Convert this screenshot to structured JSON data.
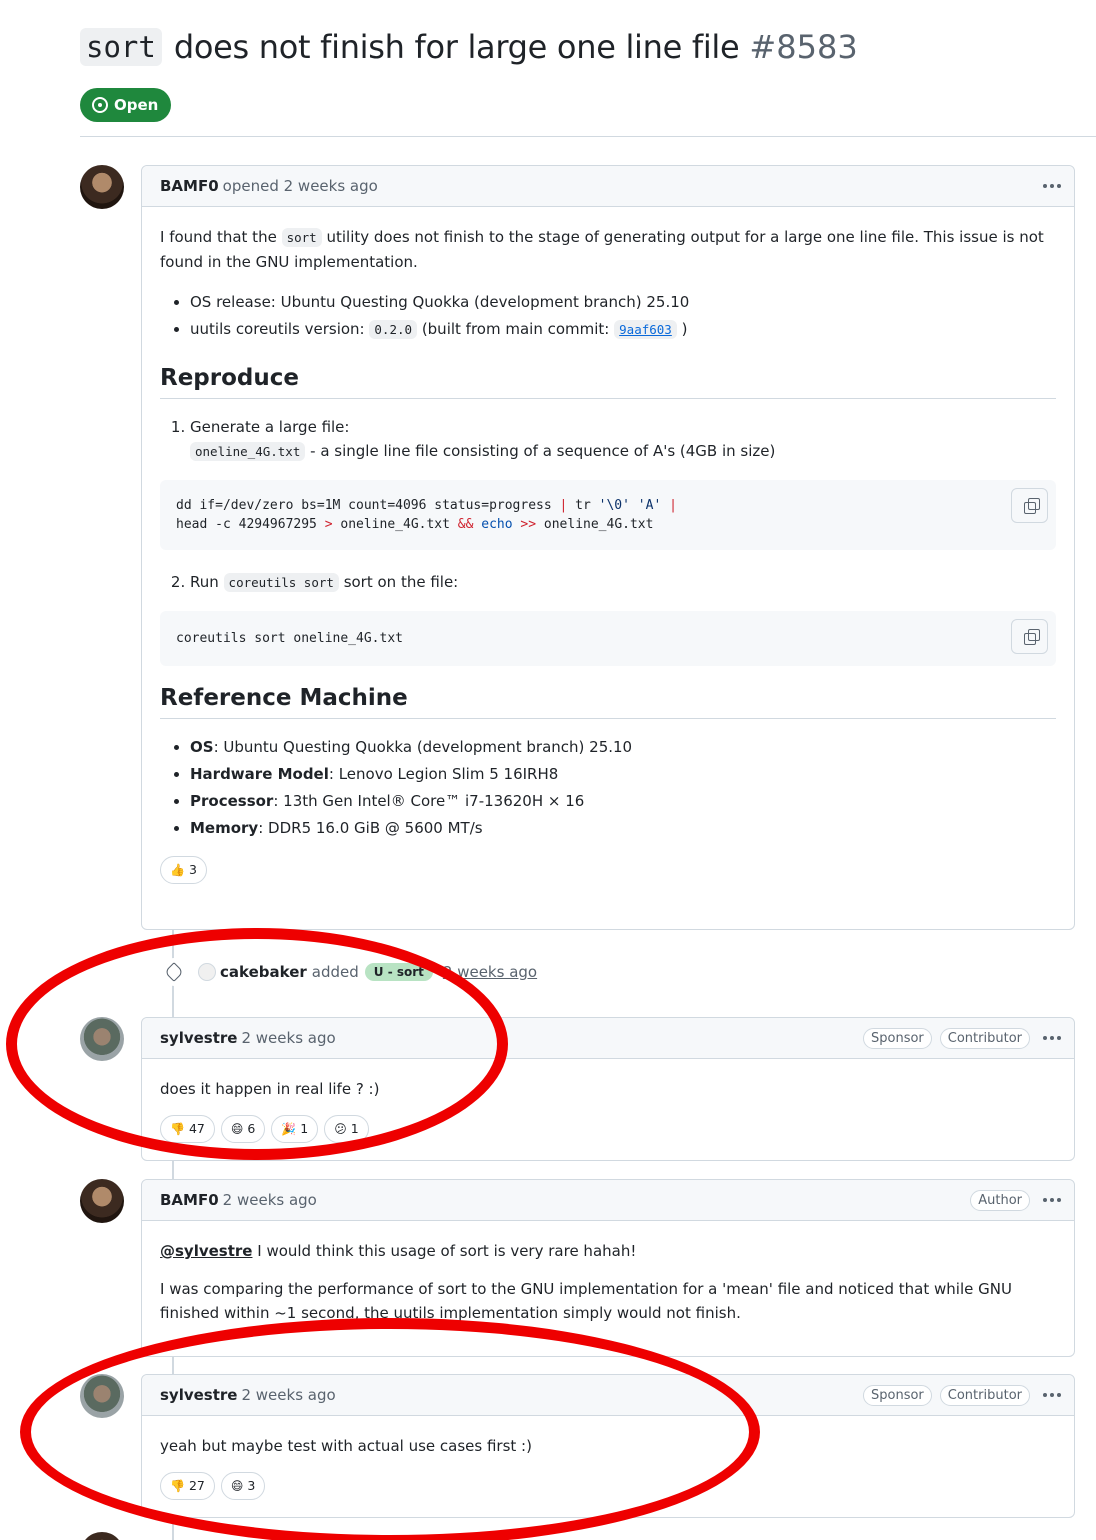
{
  "issue": {
    "title_code": "sort",
    "title_text": "does not finish for large one line file",
    "number": "#8583",
    "state": "Open"
  },
  "comments": [
    {
      "author": "BAMF0",
      "meta": "opened 2 weeks ago",
      "intro_before": "I found that the",
      "intro_code": "sort",
      "intro_after": "utility does not finish to the stage of generating output for a large one line file. This issue is not found in the GNU implementation.",
      "bullet1": "OS release: Ubuntu Questing Quokka (development branch) 25.10",
      "bullet2_before": "uutils coreutils version:",
      "bullet2_code": "0.2.0",
      "bullet2_mid": "(built from main commit:",
      "bullet2_link": "9aaf603",
      "bullet2_after": ")",
      "heading_reproduce": "Reproduce",
      "step1_title": "Generate a large file:",
      "step1_code": "oneline_4G.txt",
      "step1_desc": "- a single line file consisting of a sequence of A's (4GB in size)",
      "code1_line1_a": "dd if=/dev/zero bs=1M count=4096 status=progress ",
      "code1_line1_pipe1": "|",
      "code1_line1_b": " tr ",
      "code1_line1_s1": "'\\0'",
      "code1_line1_s2": "'A'",
      "code1_line1_pipe2": "|",
      "code1_line2_a": "head -c 4294967295 ",
      "code1_line2_gt": ">",
      "code1_line2_b": " oneline_4G.txt ",
      "code1_line2_and": "&&",
      "code1_line2_echo": "echo",
      "code1_line2_gtgt": ">>",
      "code1_line2_c": " oneline_4G.txt",
      "step2_before": "Run",
      "step2_code": "coreutils sort",
      "step2_after": "sort on the file:",
      "code2": "coreutils sort oneline_4G.txt",
      "heading_machine": "Reference Machine",
      "spec": [
        {
          "key": "OS",
          "value": ": Ubuntu Questing Quokka (development branch) 25.10"
        },
        {
          "key": "Hardware Model",
          "value": ": Lenovo Legion Slim 5 16IRH8"
        },
        {
          "key": "Processor",
          "value": ": 13th Gen Intel® Core™ i7-13620H × 16"
        },
        {
          "key": "Memory",
          "value": ": DDR5 16.0 GiB @ 5600 MT/s"
        }
      ],
      "reactions": [
        {
          "emoji": "👍",
          "count": "3"
        }
      ]
    },
    {
      "author": "sylvestre",
      "meta": "2 weeks ago",
      "badges": [
        "Sponsor",
        "Contributor"
      ],
      "body": "does it happen in real life ? :)",
      "reactions": [
        {
          "emoji": "👎",
          "count": "47"
        },
        {
          "emoji": "😄",
          "count": "6"
        },
        {
          "emoji": "🎉",
          "count": "1"
        },
        {
          "emoji": "😕",
          "count": "1"
        }
      ]
    },
    {
      "author": "BAMF0",
      "meta": "2 weeks ago",
      "badges": [
        "Author"
      ],
      "mention": "@sylvestre",
      "body1": "I would think this usage of sort is very rare hahah!",
      "body2": "I was comparing the performance of sort to the GNU implementation for a 'mean' file and noticed that while GNU finished within ~1 second, the uutils implementation simply would not finish."
    },
    {
      "author": "sylvestre",
      "meta": "2 weeks ago",
      "badges": [
        "Sponsor",
        "Contributor"
      ],
      "body": "yeah but maybe test with actual use cases first :)",
      "reactions": [
        {
          "emoji": "👎",
          "count": "27"
        },
        {
          "emoji": "😄",
          "count": "3"
        }
      ]
    }
  ],
  "event": {
    "actor": "cakebaker",
    "action": "added",
    "label": "U - sort",
    "time": "2 weeks ago",
    "label_color": "#b8e3c3"
  },
  "icons": [
    "open-issue-icon",
    "kebab-menu-icon",
    "copy-icon",
    "tag-icon"
  ],
  "colors": {
    "open_green": "#1f883d",
    "annotation_red": "#ee0000",
    "link_blue": "#0969da"
  }
}
